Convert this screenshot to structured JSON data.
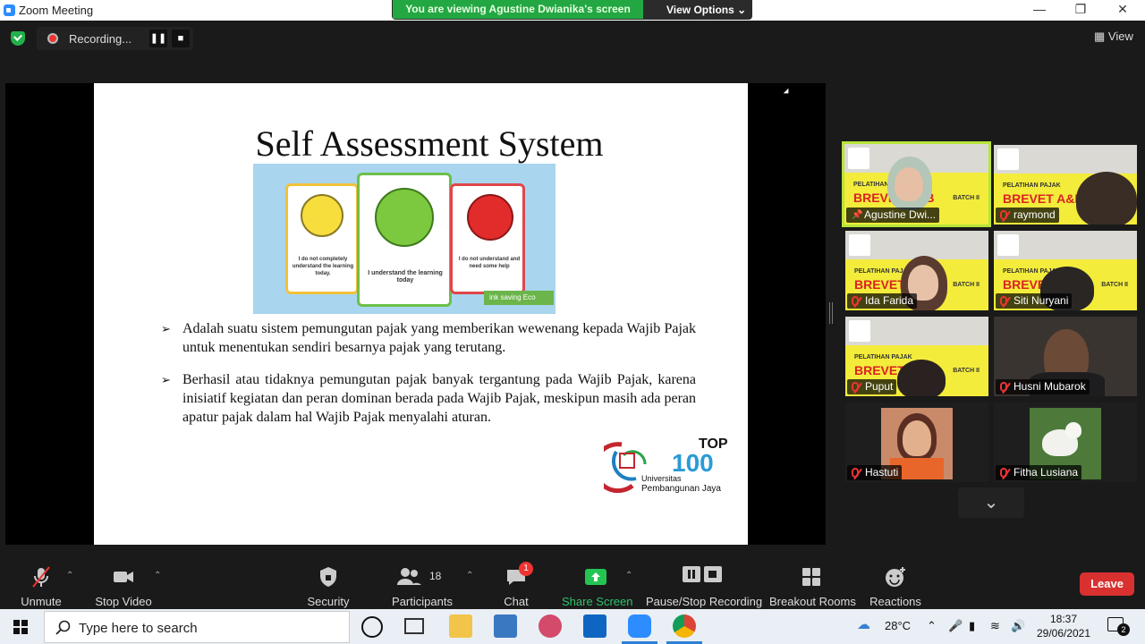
{
  "window": {
    "title": "Zoom Meeting"
  },
  "viewing_banner": {
    "text": "You are viewing Agustine Dwianika's screen",
    "options_label": "View Options"
  },
  "recording": {
    "label": "Recording..."
  },
  "view_button": {
    "label": "View"
  },
  "slide": {
    "title": "Self Assessment System",
    "face_captions": [
      "I do not completely understand the learning today.",
      "I understand the learning today",
      "I do not understand and need some help"
    ],
    "eco_label": "ink saving  Eco",
    "bullets": [
      "Adalah suatu sistem pemungutan pajak yang memberikan wewenang kepada Wajib Pajak untuk menentukan sendiri besarnya pajak yang terutang.",
      "Berhasil atau tidaknya pemungutan pajak banyak tergantung pada Wajib Pajak, karena inisiatif kegiatan dan peran dominan berada pada Wajib Pajak, meskipun masih ada peran apatur pajak dalam hal Wajib Pajak menyalahi aturan."
    ],
    "logo": {
      "top": "TOP",
      "num": "100",
      "line1": "Universitas",
      "line2": "Pembangunan Jaya"
    }
  },
  "banner_text": {
    "line1": "PELATIHAN PAJAK",
    "line2": "BREVET A&B",
    "batch": "BATCH II"
  },
  "participants": [
    {
      "name": "Agustine Dwi...",
      "pinned": true
    },
    {
      "name": "raymond",
      "muted": true
    },
    {
      "name": "Ida Farida",
      "muted": true
    },
    {
      "name": "Siti Nuryani",
      "muted": true
    },
    {
      "name": "Puput",
      "muted": true
    },
    {
      "name": "Husni Mubarok",
      "muted": true
    },
    {
      "name": "Hastuti",
      "muted": true
    },
    {
      "name": "Fitha Lusiana",
      "muted": true
    }
  ],
  "toolbar": {
    "unmute": "Unmute",
    "stop_video": "Stop Video",
    "security": "Security",
    "participants": "Participants",
    "participants_count": "18",
    "chat": "Chat",
    "chat_badge": "1",
    "share_screen": "Share Screen",
    "pause_stop_recording": "Pause/Stop Recording",
    "breakout_rooms": "Breakout Rooms",
    "reactions": "Reactions",
    "leave": "Leave"
  },
  "taskbar": {
    "search_placeholder": "Type here to search",
    "temperature": "28°C",
    "time": "18:37",
    "date": "29/06/2021",
    "notifications": "2"
  }
}
